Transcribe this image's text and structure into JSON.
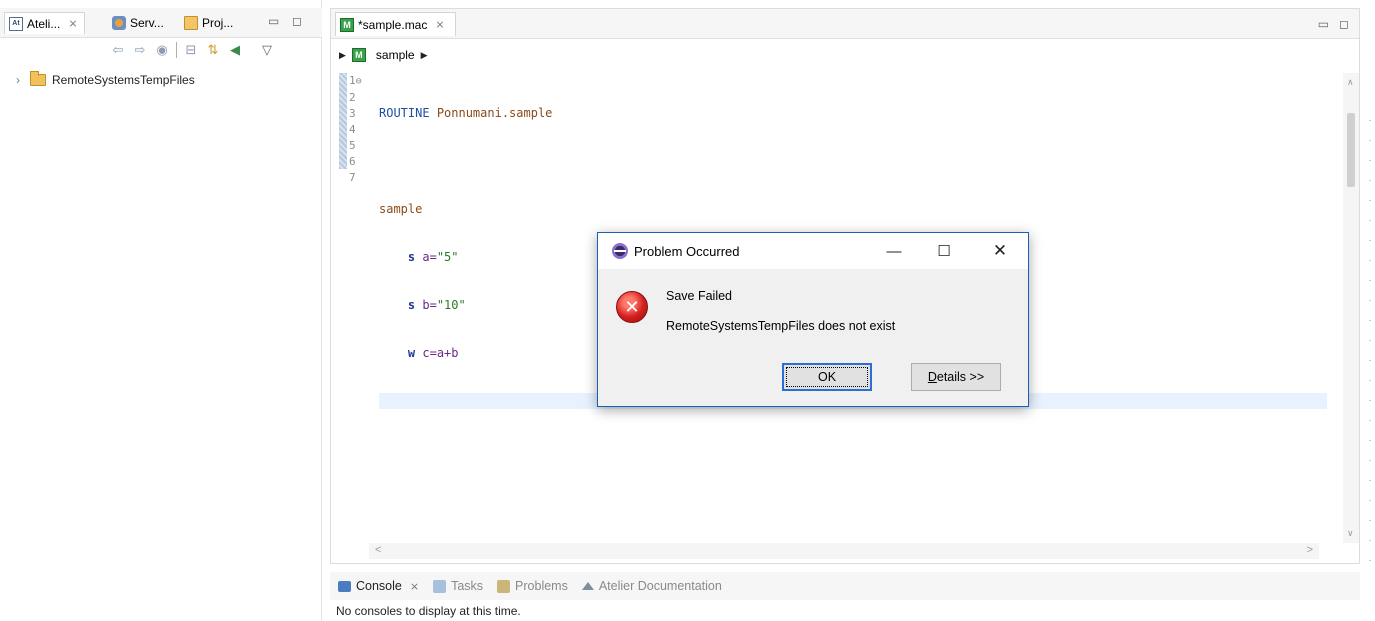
{
  "left_panel": {
    "tabs": [
      {
        "label": "Ateli...",
        "icon": "atelier-icon",
        "active": true
      },
      {
        "label": "Serv...",
        "icon": "servers-icon",
        "active": false
      },
      {
        "label": "Proj...",
        "icon": "projects-icon",
        "active": false
      }
    ],
    "tree": [
      {
        "label": "RemoteSystemsTempFiles",
        "icon": "folder-icon",
        "expanded": false
      }
    ]
  },
  "editor": {
    "tab_title": "*sample.mac",
    "breadcrumb": "sample",
    "line_numbers": [
      "1",
      "2",
      "3",
      "4",
      "5",
      "6",
      "7"
    ],
    "code": {
      "line1_keyword": "ROUTINE",
      "line1_name": "Ponnumani.sample",
      "line3_label": "sample",
      "line4_cmd": "s",
      "line4_rest": "a=",
      "line4_str": "\"5\"",
      "line5_cmd": "s",
      "line5_rest": "b=",
      "line5_str": "\"10\"",
      "line6_cmd": "w",
      "line6_rest": "c=a+b"
    }
  },
  "console": {
    "tabs": [
      {
        "label": "Console",
        "active": true
      },
      {
        "label": "Tasks",
        "active": false
      },
      {
        "label": "Problems",
        "active": false
      },
      {
        "label": "Atelier Documentation",
        "active": false
      }
    ],
    "message": "No consoles to display at this time."
  },
  "dialog": {
    "title": "Problem Occurred",
    "message_title": "Save Failed",
    "message_detail": "RemoteSystemsTempFiles does not exist",
    "ok_label": "OK",
    "details_label_prefix": "D",
    "details_label_rest": "etails >>"
  }
}
